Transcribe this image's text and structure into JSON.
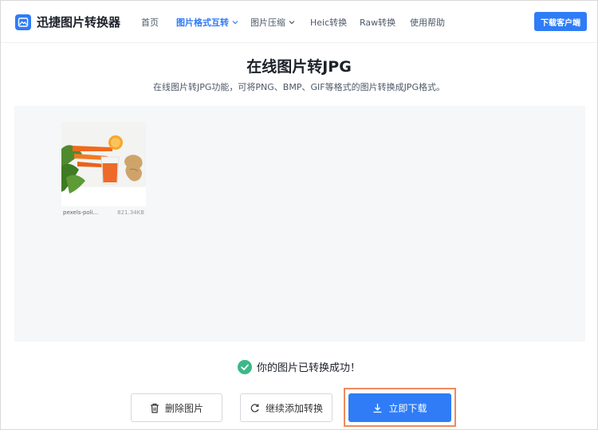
{
  "brand": {
    "name": "迅捷图片转换器",
    "icon": "image-logo-icon",
    "color": "#2f7cf6"
  },
  "nav": {
    "items": [
      {
        "label": "首页"
      },
      {
        "label": "图片格式互转",
        "active": true,
        "has_dropdown": true
      },
      {
        "label": "图片压缩",
        "has_dropdown": true
      },
      {
        "label": "Heic转换"
      },
      {
        "label": "Raw转换"
      },
      {
        "label": "使用帮助"
      }
    ],
    "download_client": "下载客户端"
  },
  "page": {
    "title": "在线图片转JPG",
    "subtitle": "在线图片转JPG功能，可将PNG、BMP、GIF等格式的图片转换成JPG格式。"
  },
  "files": [
    {
      "name": "pexels-poli...",
      "size": "821.34KB"
    }
  ],
  "status": {
    "message": "你的图片已转换成功！",
    "icon": "check-circle-icon",
    "color": "#3cb88a"
  },
  "actions": {
    "delete": "删除图片",
    "continue": "继续添加转换",
    "download": "立即下载"
  }
}
